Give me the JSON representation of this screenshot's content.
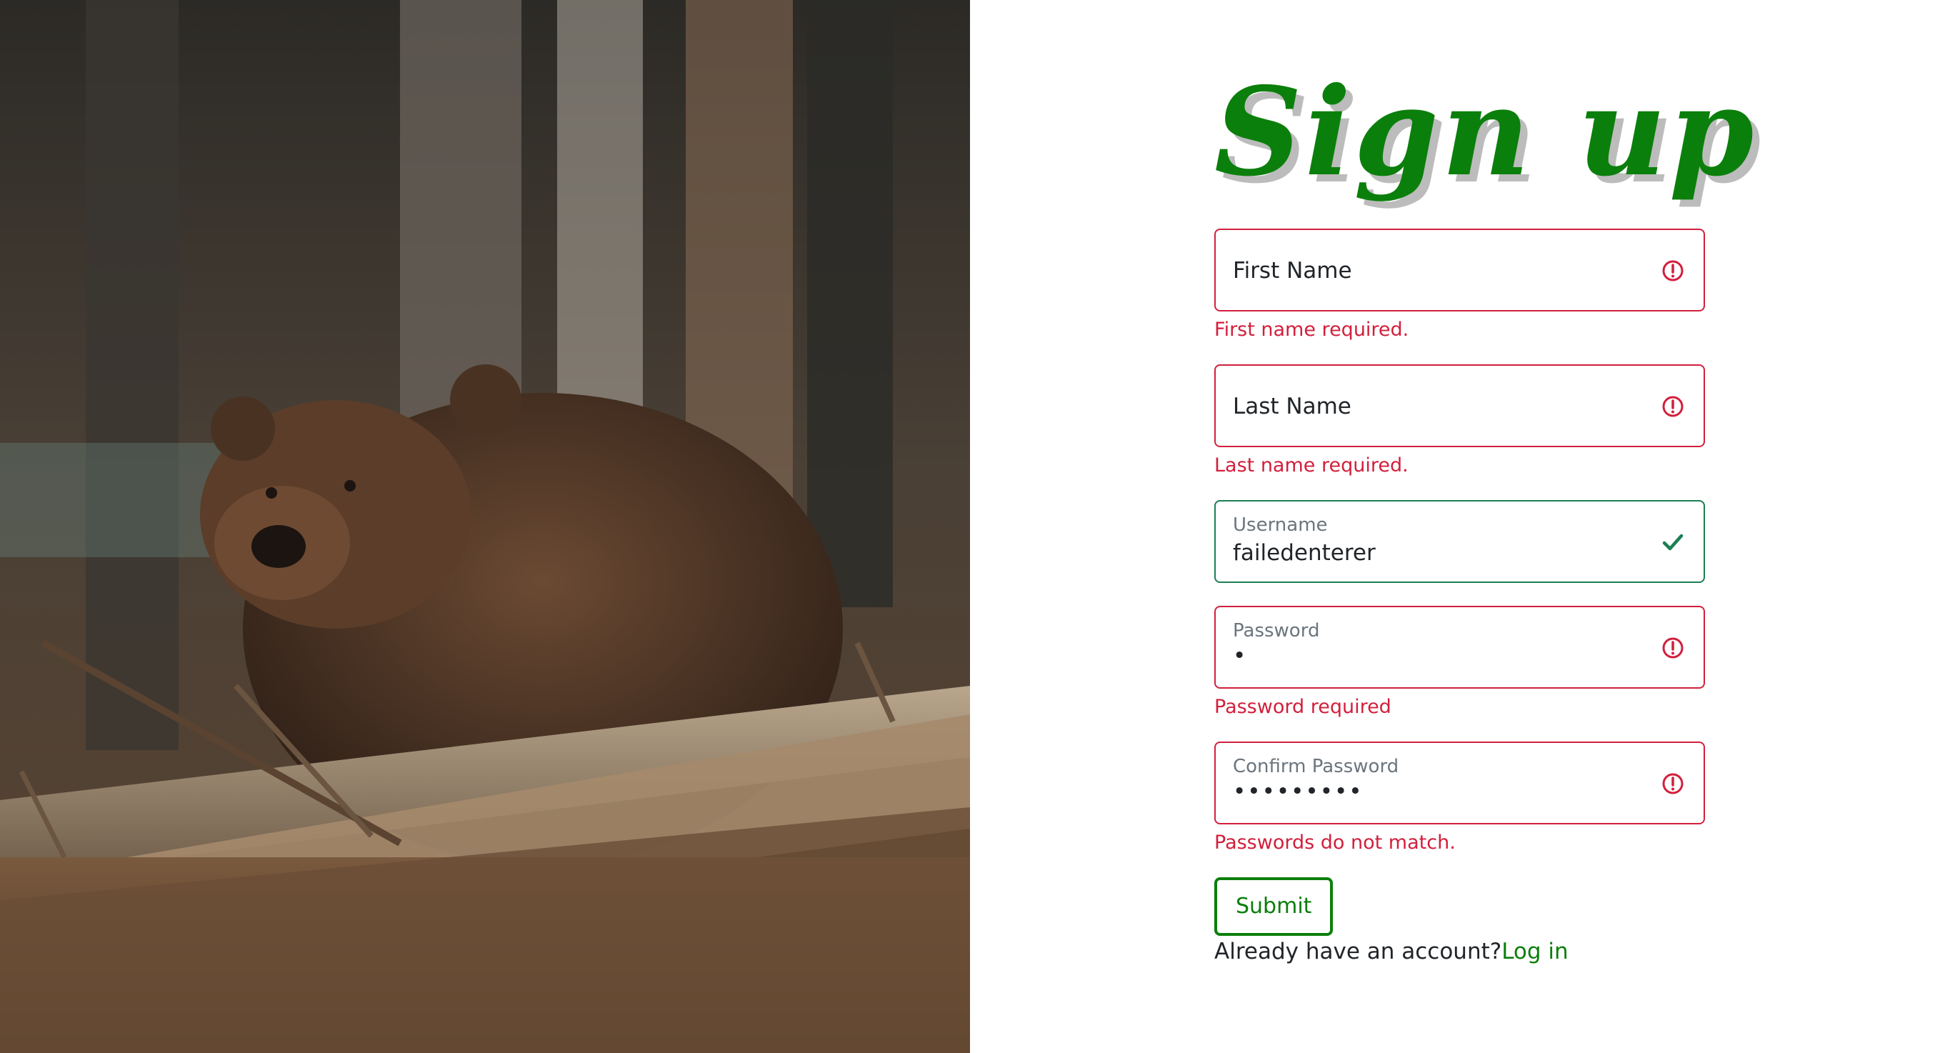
{
  "signup": {
    "title": "Sign up",
    "first_name": {
      "placeholder": "First Name",
      "value": "",
      "status": "invalid",
      "error": "First name required."
    },
    "last_name": {
      "placeholder": "Last Name",
      "value": "",
      "status": "invalid",
      "error": "Last name required."
    },
    "username": {
      "label": "Username",
      "value": "failedenterer",
      "status": "valid"
    },
    "password": {
      "label": "Password",
      "masked_value": "•",
      "status": "invalid",
      "error": "Password required"
    },
    "confirm_password": {
      "label": "Confirm Password",
      "masked_value": "•••••••••",
      "status": "invalid",
      "error": "Passwords do not match."
    },
    "submit_label": "Submit",
    "login_prompt": "Already have an account?",
    "login_link": "Log in"
  },
  "icons": {
    "invalid": "exclamation-circle-icon",
    "valid": "checkmark-icon"
  },
  "colors": {
    "accent": "#0b7f0b",
    "error": "#d21f3c",
    "valid": "#1a7f52",
    "title_shadow": "#bcbcbc"
  }
}
